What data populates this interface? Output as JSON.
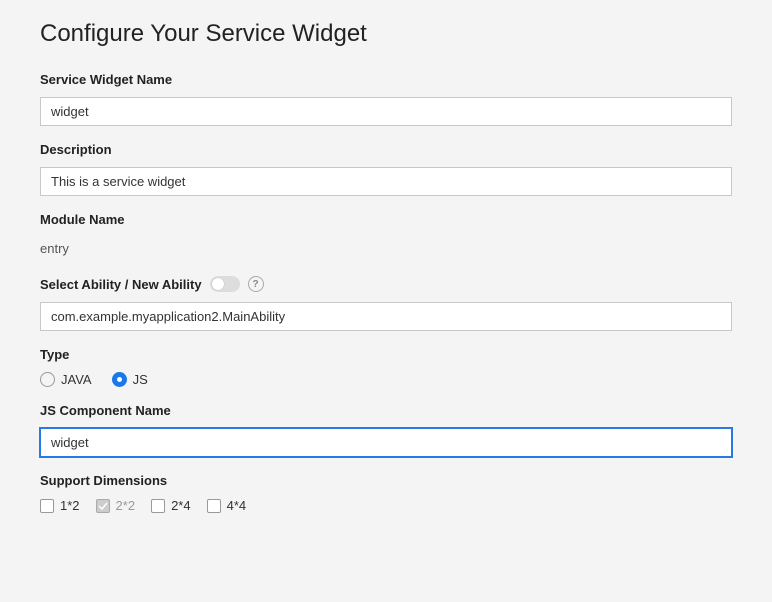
{
  "title": "Configure Your Service Widget",
  "fields": {
    "widgetName": {
      "label": "Service Widget Name",
      "value": "widget"
    },
    "description": {
      "label": "Description",
      "value": "This is a service widget"
    },
    "moduleName": {
      "label": "Module Name",
      "value": "entry"
    },
    "selectAbility": {
      "label": "Select Ability / New Ability",
      "value": "com.example.myapplication2.MainAbility"
    },
    "type": {
      "label": "Type",
      "options": {
        "java": "JAVA",
        "js": "JS"
      }
    },
    "jsComponentName": {
      "label": "JS Component Name",
      "value": "widget"
    },
    "supportDimensions": {
      "label": "Support Dimensions",
      "options": {
        "d1x2": "1*2",
        "d2x2": "2*2",
        "d2x4": "2*4",
        "d4x4": "4*4"
      }
    }
  }
}
